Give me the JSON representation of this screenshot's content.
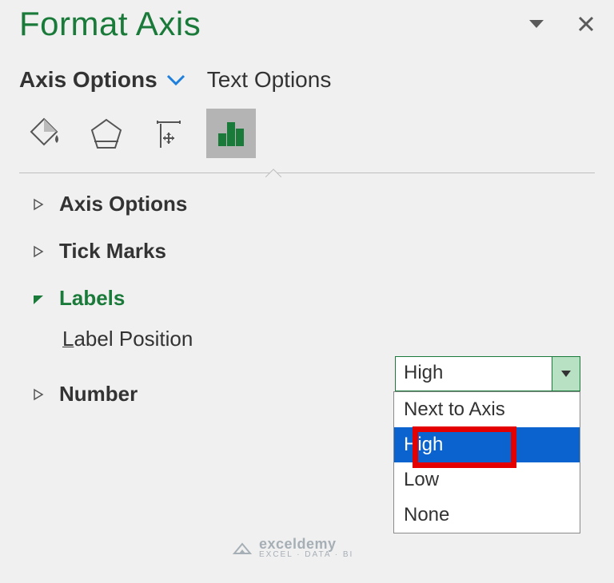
{
  "title": "Format Axis",
  "categories": {
    "axis_options": "Axis Options",
    "text_options": "Text Options"
  },
  "sections": {
    "axis_options": "Axis Options",
    "tick_marks": "Tick Marks",
    "labels": "Labels",
    "number": "Number"
  },
  "label_position": {
    "label_prefix": "L",
    "label_rest": "abel Position",
    "value": "High",
    "options": [
      "Next to Axis",
      "High",
      "Low",
      "None"
    ],
    "selected_index": 1
  },
  "watermark": {
    "main": "exceldemy",
    "sub": "EXCEL · DATA · BI"
  }
}
